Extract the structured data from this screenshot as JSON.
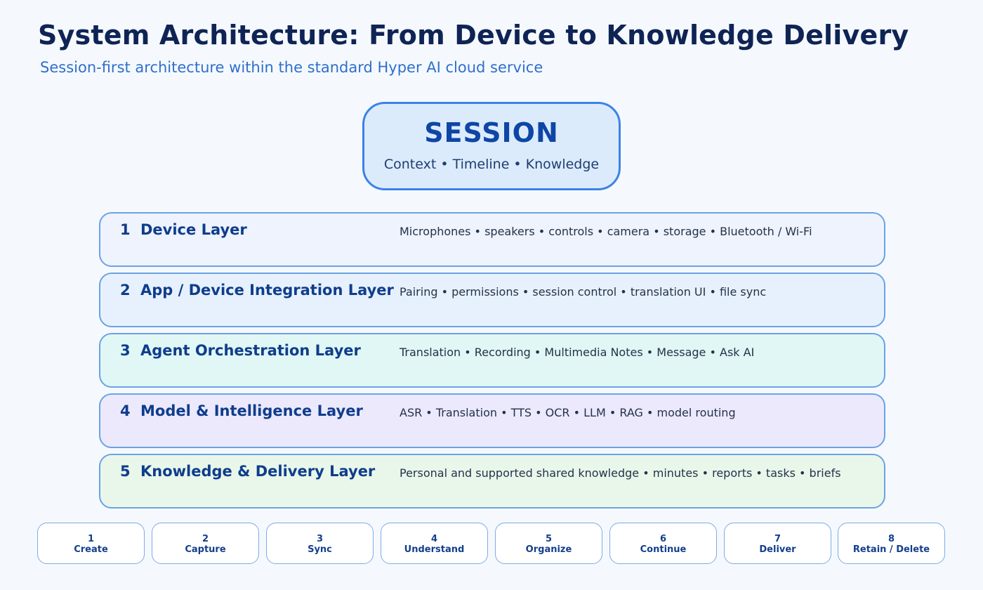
{
  "header": {
    "title": "System Architecture: From Device to Knowledge Delivery",
    "subtitle": "Session-first architecture within the standard Hyper AI cloud service"
  },
  "session": {
    "title": "SESSION",
    "subtitle": "Context • Timeline • Knowledge"
  },
  "layers": [
    {
      "num": "1",
      "name": "Device Layer",
      "desc": "Microphones • speakers • controls • camera • storage • Bluetooth / Wi-Fi",
      "color": "#eef3fd"
    },
    {
      "num": "2",
      "name": "App / Device Integration Layer",
      "desc": "Pairing • permissions • session control • translation UI • file sync",
      "color": "#e7f1fd"
    },
    {
      "num": "3",
      "name": "Agent Orchestration Layer",
      "desc": "Translation • Recording • Multimedia Notes • Message • Ask AI",
      "color": "#e0f7f5"
    },
    {
      "num": "4",
      "name": "Model & Intelligence Layer",
      "desc": "ASR • Translation • TTS • OCR • LLM • RAG • model routing",
      "color": "#ece9fd"
    },
    {
      "num": "5",
      "name": "Knowledge & Delivery Layer",
      "desc": "Personal and supported shared knowledge • minutes • reports • tasks • briefs",
      "color": "#e9f7ea"
    }
  ],
  "steps": [
    {
      "num": "1",
      "label": "Create"
    },
    {
      "num": "2",
      "label": "Capture"
    },
    {
      "num": "3",
      "label": "Sync"
    },
    {
      "num": "4",
      "label": "Understand"
    },
    {
      "num": "5",
      "label": "Organize"
    },
    {
      "num": "6",
      "label": "Continue"
    },
    {
      "num": "7",
      "label": "Deliver"
    },
    {
      "num": "8",
      "label": "Retain / Delete"
    }
  ],
  "colors": {
    "title": "#0f2455",
    "accent": "#2f6fcb",
    "session_border": "#3d82e6",
    "layer_border": "#6ca2e4"
  }
}
